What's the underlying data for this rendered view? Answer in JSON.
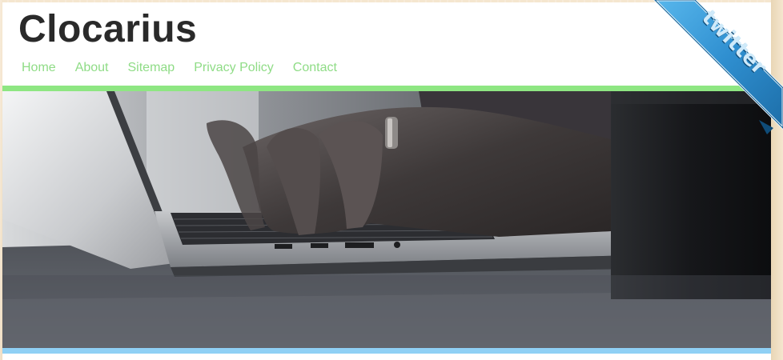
{
  "site": {
    "title": "Clocarius"
  },
  "nav": {
    "items": [
      {
        "label": "Home"
      },
      {
        "label": "About"
      },
      {
        "label": "Sitemap"
      },
      {
        "label": "Privacy Policy"
      },
      {
        "label": "Contact"
      }
    ]
  },
  "ribbon": {
    "label": "twitter",
    "icon": "twitter-ribbon-icon"
  },
  "colors": {
    "nav_text": "#8fdc86",
    "header_rule": "#8ee682",
    "hero_rule": "#8fd0f5",
    "ribbon_blue": "#2f8fd0",
    "title_text": "#2a2a2a"
  }
}
